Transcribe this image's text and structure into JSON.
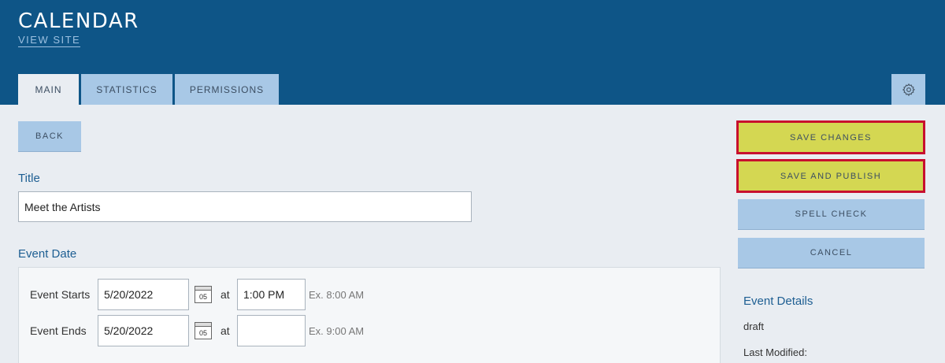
{
  "header": {
    "title": "CALENDAR",
    "view_site": "VIEW SITE"
  },
  "tabs": [
    {
      "label": "MAIN",
      "active": true
    },
    {
      "label": "STATISTICS",
      "active": false
    },
    {
      "label": "PERMISSIONS",
      "active": false
    }
  ],
  "toolbar": {
    "settings_icon": "gear-icon"
  },
  "buttons": {
    "back": "BACK",
    "save_changes": "SAVE CHANGES",
    "save_publish": "SAVE AND PUBLISH",
    "spell_check": "SPELL CHECK",
    "cancel": "CANCEL"
  },
  "form": {
    "title_label": "Title",
    "title_value": "Meet the Artists",
    "event_date_label": "Event Date",
    "starts": {
      "label": "Event Starts",
      "date": "5/20/2022",
      "calendar_day": "05",
      "at": "at",
      "time": "1:00 PM",
      "hint": "Ex. 8:00 AM"
    },
    "ends": {
      "label": "Event Ends",
      "date": "5/20/2022",
      "calendar_day": "05",
      "at": "at",
      "time": "",
      "hint": "Ex. 9:00 AM"
    }
  },
  "details": {
    "heading": "Event Details",
    "status": "draft",
    "last_modified_label": "Last Modified:"
  },
  "colors": {
    "header_bg": "#0e5587",
    "tab_inactive": "#a8c8e6",
    "highlight_yellow": "#d4d752",
    "highlight_border": "#c8102e"
  }
}
